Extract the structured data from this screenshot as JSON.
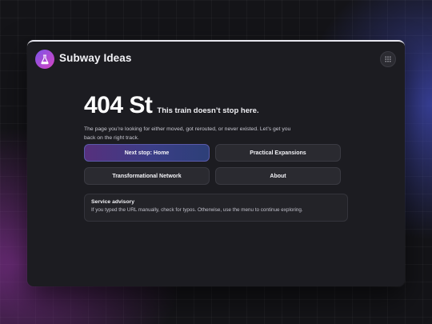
{
  "app": {
    "brand": "Subway Ideas",
    "logo_icon": "flask-icon",
    "menu_icon": "grid-menu-icon"
  },
  "error": {
    "title": "404 St",
    "subtitle": "This train doesn’t stop here.",
    "description": "The page you’re looking for either moved, got rerouted, or never existed. Let’s get you back on the right track."
  },
  "buttons": [
    {
      "label": "Next stop: Home",
      "style": "primary"
    },
    {
      "label": "Practical Expansions",
      "style": "secondary"
    },
    {
      "label": "Transformational Network",
      "style": "secondary"
    },
    {
      "label": "About",
      "style": "secondary"
    }
  ],
  "advisory": {
    "title": "Service advisory",
    "text": "If you typed the URL manually, check for typos. Otherwise, use the menu to continue exploring."
  },
  "colors": {
    "background": "#141418",
    "panel": "#1c1c21",
    "accent_purple": "#7b54e8",
    "accent_pink": "#d544c2",
    "primary_button_start": "#56307d",
    "primary_button_end": "#2d3f78"
  }
}
